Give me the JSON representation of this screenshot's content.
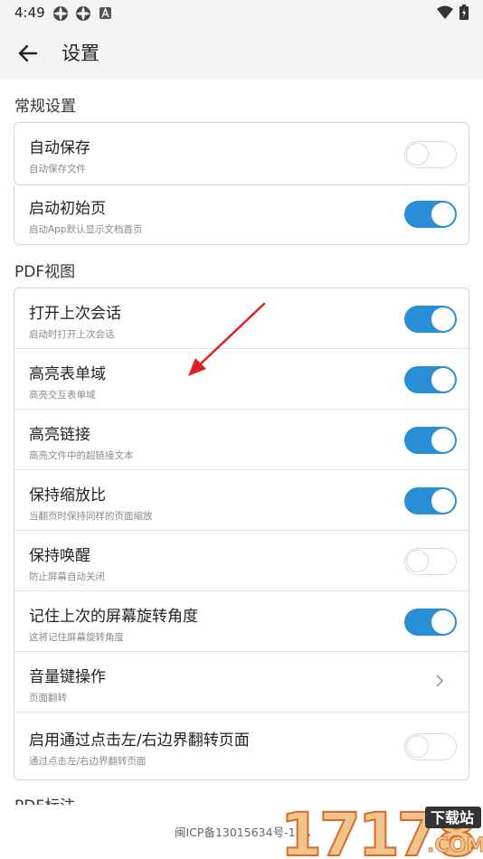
{
  "status_bar": {
    "time": "4:49",
    "icons": [
      "app-notification-icon",
      "app-notification-icon",
      "a-square-icon",
      "wifi-icon",
      "battery-icon"
    ]
  },
  "app_bar": {
    "back_icon": "arrow-left-icon",
    "title": "设置"
  },
  "sections": {
    "general": {
      "title": "常规设置",
      "items": [
        {
          "title": "自动保存",
          "subtitle": "自动保存文件",
          "control": "toggle",
          "on": false
        },
        {
          "title": "启动初始页",
          "subtitle": "启动App默认显示文档首页",
          "control": "toggle",
          "on": true
        }
      ]
    },
    "pdf_view": {
      "title": "PDF视图",
      "items": [
        {
          "title": "打开上次会话",
          "subtitle": "启动时打开上次会话",
          "control": "toggle",
          "on": true
        },
        {
          "title": "高亮表单域",
          "subtitle": "高亮交互表单域",
          "control": "toggle",
          "on": true
        },
        {
          "title": "高亮链接",
          "subtitle": "高亮文件中的超链接文本",
          "control": "toggle",
          "on": true
        },
        {
          "title": "保持缩放比",
          "subtitle": "当翻页时保持同样的页面缩放",
          "control": "toggle",
          "on": true
        },
        {
          "title": "保持唤醒",
          "subtitle": "防止屏幕自动关闭",
          "control": "toggle",
          "on": false
        },
        {
          "title": "记住上次的屏幕旋转角度",
          "subtitle": "这将记住屏幕旋转角度",
          "control": "toggle",
          "on": true
        },
        {
          "title": "音量键操作",
          "subtitle": "页面翻转",
          "control": "chevron"
        },
        {
          "title": "启用通过点击左/右边界翻转页面",
          "subtitle": "通过点击左/右边界翻转页面",
          "control": "toggle",
          "on": false
        }
      ]
    },
    "pdf_annot": {
      "title": "PDF标注"
    }
  },
  "footer": {
    "icp": "闽ICP备13015634号-17A"
  },
  "watermark": {
    "number": "17178",
    "badge": "下载站",
    "domain": ".COM"
  },
  "colors": {
    "accent": "#2a8ed6",
    "annotation_arrow": "#e02020"
  }
}
